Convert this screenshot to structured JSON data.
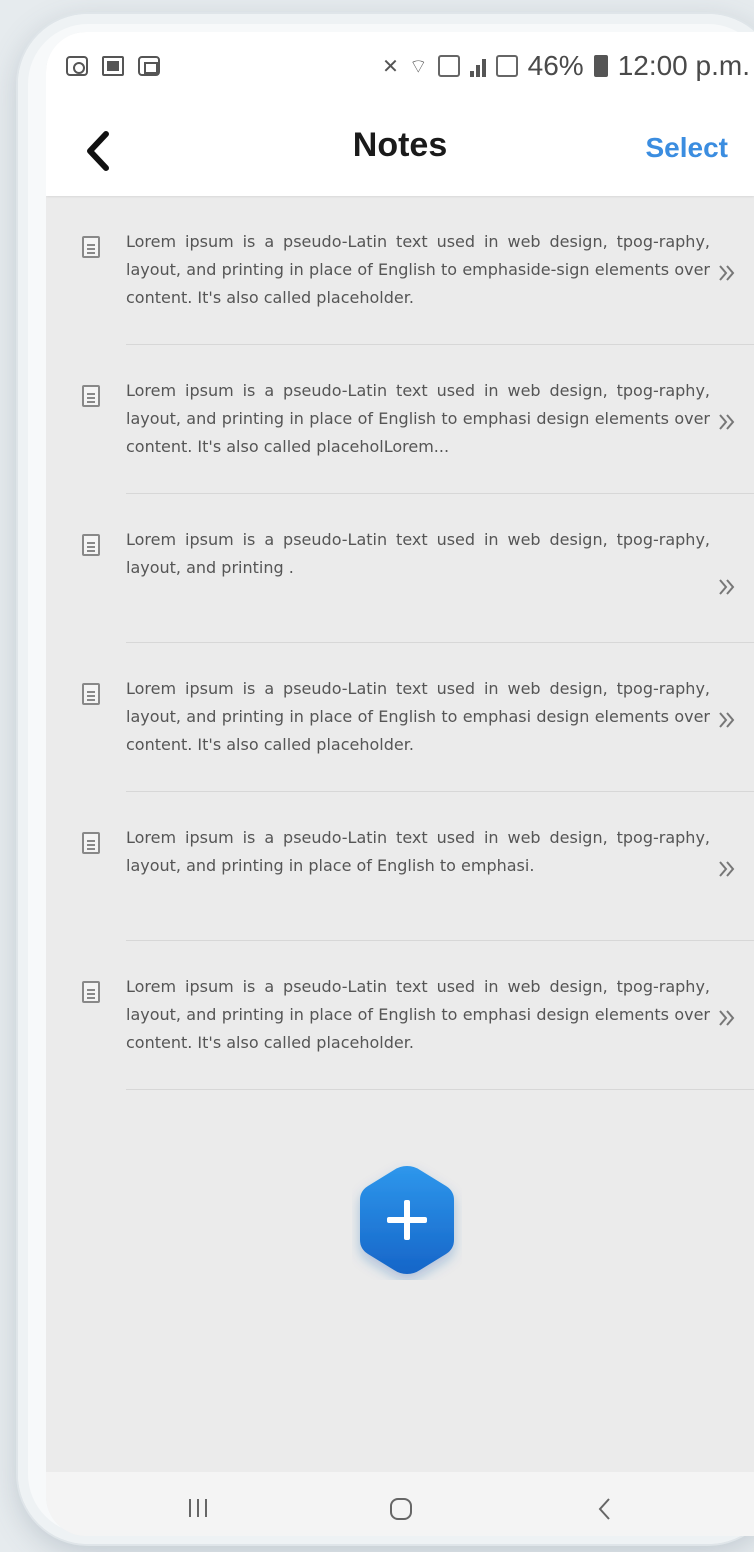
{
  "status": {
    "battery_percent": "46%",
    "time": "12:00 p.m."
  },
  "header": {
    "title": "Notes",
    "select_label": "Select"
  },
  "notes": [
    {
      "text": "Lorem ipsum is a pseudo-Latin text used in web design, tpog-raphy, layout, and printing in place of English to emphaside-sign elements over content. It's also called placeholder."
    },
    {
      "text": "Lorem ipsum is a pseudo-Latin text used in web design, tpog-raphy, layout, and printing in place of English to emphasi design elements over content. It's also called placeholLorem..."
    },
    {
      "text": "Lorem ipsum is a pseudo-Latin text used in web design, tpog-raphy, layout, and printing ."
    },
    {
      "text": "Lorem ipsum is a pseudo-Latin text used in web design, tpog-raphy, layout, and printing in place of English to emphasi design elements over content. It's also called placeholder."
    },
    {
      "text": "Lorem ipsum is a pseudo-Latin text used in web design, tpog-raphy, layout, and printing in place of English to emphasi."
    },
    {
      "text": "Lorem ipsum is a pseudo-Latin text used in web design, tpog-raphy, layout, and printing in place of English to emphasi design elements over content. It's also called placeholder."
    }
  ],
  "colors": {
    "accent": "#3b8de0",
    "fab_gradient_top": "#2a8fe6",
    "fab_gradient_bottom": "#1665c8"
  },
  "icons": {
    "back": "chevron-left-icon",
    "note": "document-icon",
    "row_arrow": "double-chevron-right-icon",
    "add": "plus-icon",
    "nav_recent": "recent-apps-icon",
    "nav_home": "home-icon",
    "nav_back": "back-icon"
  }
}
